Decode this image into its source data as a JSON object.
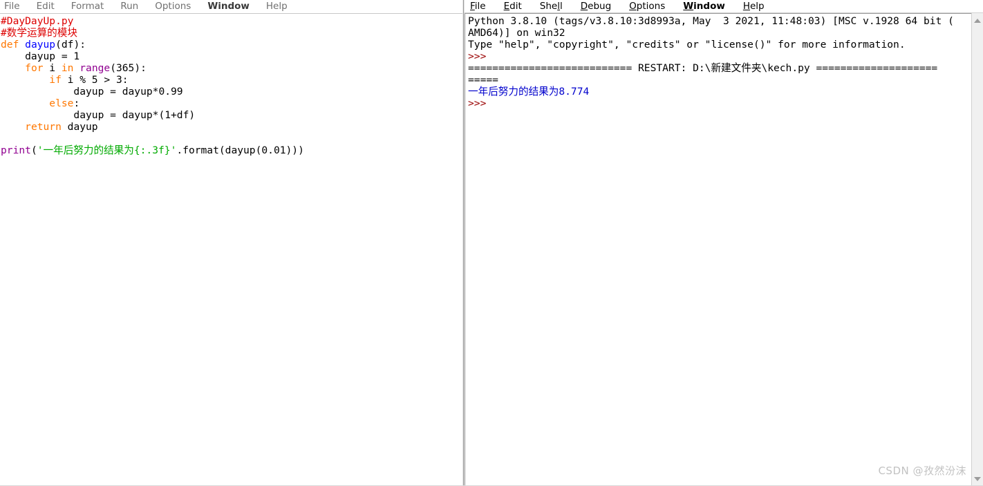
{
  "editor": {
    "menu": [
      {
        "label": "File",
        "strong": false
      },
      {
        "label": "Edit",
        "strong": false
      },
      {
        "label": "Format",
        "strong": false
      },
      {
        "label": "Run",
        "strong": false
      },
      {
        "label": "Options",
        "strong": false
      },
      {
        "label": "Window",
        "strong": true
      },
      {
        "label": "Help",
        "strong": false
      }
    ],
    "code_lines": [
      {
        "tokens": [
          {
            "t": "#DayDayUp.py",
            "c": "c-comment"
          }
        ]
      },
      {
        "tokens": [
          {
            "t": "#数学运算的模块",
            "c": "c-comment"
          }
        ]
      },
      {
        "tokens": [
          {
            "t": "def ",
            "c": "c-keyword"
          },
          {
            "t": "dayup",
            "c": "c-defname"
          },
          {
            "t": "(df):",
            "c": "c-plain"
          }
        ]
      },
      {
        "tokens": [
          {
            "t": "    dayup = 1",
            "c": "c-plain"
          }
        ]
      },
      {
        "tokens": [
          {
            "t": "    ",
            "c": "c-plain"
          },
          {
            "t": "for",
            "c": "c-keyword"
          },
          {
            "t": " i ",
            "c": "c-plain"
          },
          {
            "t": "in",
            "c": "c-keyword"
          },
          {
            "t": " ",
            "c": "c-plain"
          },
          {
            "t": "range",
            "c": "c-builtin"
          },
          {
            "t": "(365):",
            "c": "c-plain"
          }
        ]
      },
      {
        "tokens": [
          {
            "t": "        ",
            "c": "c-plain"
          },
          {
            "t": "if",
            "c": "c-keyword"
          },
          {
            "t": " i % 5 > 3:",
            "c": "c-plain"
          }
        ]
      },
      {
        "tokens": [
          {
            "t": "            dayup = dayup*0.99",
            "c": "c-plain"
          }
        ]
      },
      {
        "tokens": [
          {
            "t": "        ",
            "c": "c-plain"
          },
          {
            "t": "else",
            "c": "c-keyword"
          },
          {
            "t": ":",
            "c": "c-plain"
          }
        ]
      },
      {
        "tokens": [
          {
            "t": "            dayup = dayup*(1+df)",
            "c": "c-plain"
          }
        ]
      },
      {
        "tokens": [
          {
            "t": "    ",
            "c": "c-plain"
          },
          {
            "t": "return",
            "c": "c-keyword"
          },
          {
            "t": " dayup",
            "c": "c-plain"
          }
        ]
      },
      {
        "tokens": []
      },
      {
        "tokens": [
          {
            "t": "print",
            "c": "c-builtin"
          },
          {
            "t": "(",
            "c": "c-plain"
          },
          {
            "t": "'一年后努力的结果为{:.3f}'",
            "c": "c-string"
          },
          {
            "t": ".format(dayup(0.01)))",
            "c": "c-plain"
          }
        ]
      }
    ]
  },
  "shell": {
    "menu": [
      {
        "pre": "",
        "mn": "F",
        "post": "ile",
        "strong": false
      },
      {
        "pre": "",
        "mn": "E",
        "post": "dit",
        "strong": false
      },
      {
        "pre": "She",
        "mn": "l",
        "post": "l",
        "strong": false
      },
      {
        "pre": "",
        "mn": "D",
        "post": "ebug",
        "strong": false
      },
      {
        "pre": "",
        "mn": "O",
        "post": "ptions",
        "strong": false
      },
      {
        "pre": "",
        "mn": "W",
        "post": "indow",
        "strong": true
      },
      {
        "pre": "",
        "mn": "H",
        "post": "elp",
        "strong": false
      }
    ],
    "lines": [
      {
        "tokens": [
          {
            "t": "Python 3.8.10 (tags/v3.8.10:3d8993a, May  3 2021, 11:48:03) [MSC v.1928 64 bit (",
            "c": "s-restart"
          }
        ]
      },
      {
        "tokens": [
          {
            "t": "AMD64)] on win32",
            "c": "s-restart"
          }
        ]
      },
      {
        "tokens": [
          {
            "t": "Type \"help\", \"copyright\", \"credits\" or \"license()\" for more information.",
            "c": "s-restart"
          }
        ]
      },
      {
        "tokens": [
          {
            "t": ">>>",
            "c": "s-prompt"
          }
        ]
      },
      {
        "tokens": [
          {
            "t": "=========================== RESTART: D:\\新建文件夹\\kech.py ====================",
            "c": "s-restart"
          }
        ]
      },
      {
        "tokens": [
          {
            "t": "=====",
            "c": "s-restart"
          }
        ]
      },
      {
        "tokens": [
          {
            "t": "一年后努力的结果为8.774",
            "c": "s-output"
          }
        ]
      },
      {
        "tokens": [
          {
            "t": ">>>",
            "c": "s-prompt"
          }
        ]
      }
    ],
    "scrollbar": {
      "up_icon": "triangle-up-icon",
      "down_icon": "triangle-down-icon"
    }
  },
  "watermark": {
    "text": "CSDN @孜然汾沫"
  }
}
